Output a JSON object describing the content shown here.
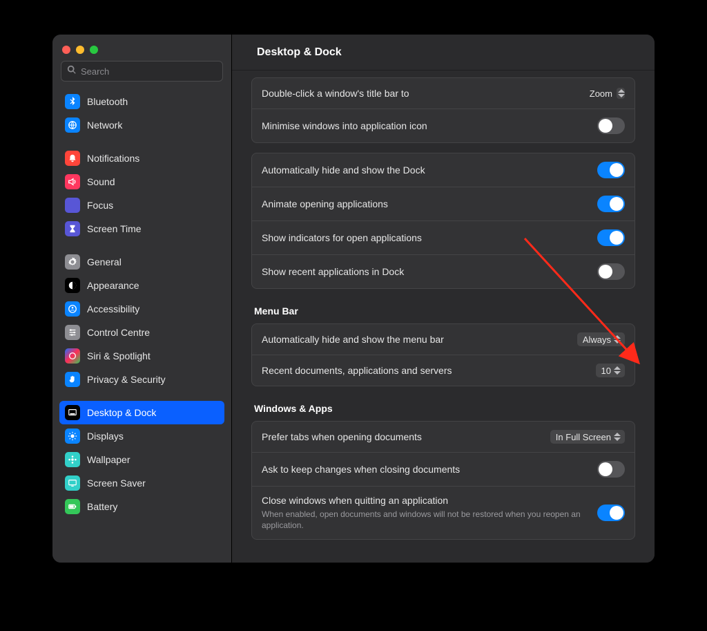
{
  "header": {
    "title": "Desktop & Dock"
  },
  "search": {
    "placeholder": "Search"
  },
  "sidebar": {
    "items": [
      {
        "id": "bluetooth",
        "label": "Bluetooth",
        "iconClass": "ic-bluetooth",
        "icon": "bluetooth"
      },
      {
        "id": "network",
        "label": "Network",
        "iconClass": "ic-network",
        "icon": "globe"
      },
      {
        "id": "notif",
        "label": "Notifications",
        "iconClass": "ic-notif",
        "icon": "bell"
      },
      {
        "id": "sound",
        "label": "Sound",
        "iconClass": "ic-sound",
        "icon": "speaker"
      },
      {
        "id": "focus",
        "label": "Focus",
        "iconClass": "ic-focus",
        "icon": "moon"
      },
      {
        "id": "screentime",
        "label": "Screen Time",
        "iconClass": "ic-screentime",
        "icon": "hourglass"
      },
      {
        "id": "general",
        "label": "General",
        "iconClass": "ic-general",
        "icon": "gear"
      },
      {
        "id": "appearance",
        "label": "Appearance",
        "iconClass": "ic-appearance",
        "icon": "contrast"
      },
      {
        "id": "access",
        "label": "Accessibility",
        "iconClass": "ic-access",
        "icon": "person"
      },
      {
        "id": "cc",
        "label": "Control Centre",
        "iconClass": "ic-cc",
        "icon": "sliders"
      },
      {
        "id": "siri",
        "label": "Siri & Spotlight",
        "iconClass": "ic-siri",
        "icon": "siri"
      },
      {
        "id": "privacy",
        "label": "Privacy & Security",
        "iconClass": "ic-privacy",
        "icon": "hand"
      },
      {
        "id": "desktop",
        "label": "Desktop & Dock",
        "iconClass": "ic-desktop",
        "icon": "dock",
        "selected": true
      },
      {
        "id": "displays",
        "label": "Displays",
        "iconClass": "ic-displays",
        "icon": "sun"
      },
      {
        "id": "wallpaper",
        "label": "Wallpaper",
        "iconClass": "ic-wallpaper",
        "icon": "flower"
      },
      {
        "id": "saver",
        "label": "Screen Saver",
        "iconClass": "ic-saver",
        "icon": "screen"
      },
      {
        "id": "battery",
        "label": "Battery",
        "iconClass": "ic-battery",
        "icon": "battery"
      }
    ],
    "groupBreaks": [
      2,
      6,
      12
    ]
  },
  "sections": [
    {
      "rows": [
        {
          "kind": "popup",
          "label": "Double-click a window's title bar to",
          "value": "Zoom",
          "flat": true
        },
        {
          "kind": "toggle",
          "label": "Minimise windows into application icon",
          "on": false
        }
      ]
    },
    {
      "rows": [
        {
          "kind": "toggle",
          "label": "Automatically hide and show the Dock",
          "on": true
        },
        {
          "kind": "toggle",
          "label": "Animate opening applications",
          "on": true
        },
        {
          "kind": "toggle",
          "label": "Show indicators for open applications",
          "on": true
        },
        {
          "kind": "toggle",
          "label": "Show recent applications in Dock",
          "on": false
        }
      ]
    },
    {
      "title": "Menu Bar",
      "rows": [
        {
          "kind": "popup",
          "label": "Automatically hide and show the menu bar",
          "value": "Always"
        },
        {
          "kind": "popup",
          "label": "Recent documents, applications and servers",
          "value": "10"
        }
      ]
    },
    {
      "title": "Windows & Apps",
      "rows": [
        {
          "kind": "popup",
          "label": "Prefer tabs when opening documents",
          "value": "In Full Screen"
        },
        {
          "kind": "toggle",
          "label": "Ask to keep changes when closing documents",
          "on": false
        },
        {
          "kind": "toggle",
          "label": "Close windows when quitting an application",
          "on": true,
          "sub": "When enabled, open documents and windows will not be restored when you reopen an application."
        }
      ]
    }
  ],
  "annotation": {
    "color": "#ff2a1a"
  }
}
